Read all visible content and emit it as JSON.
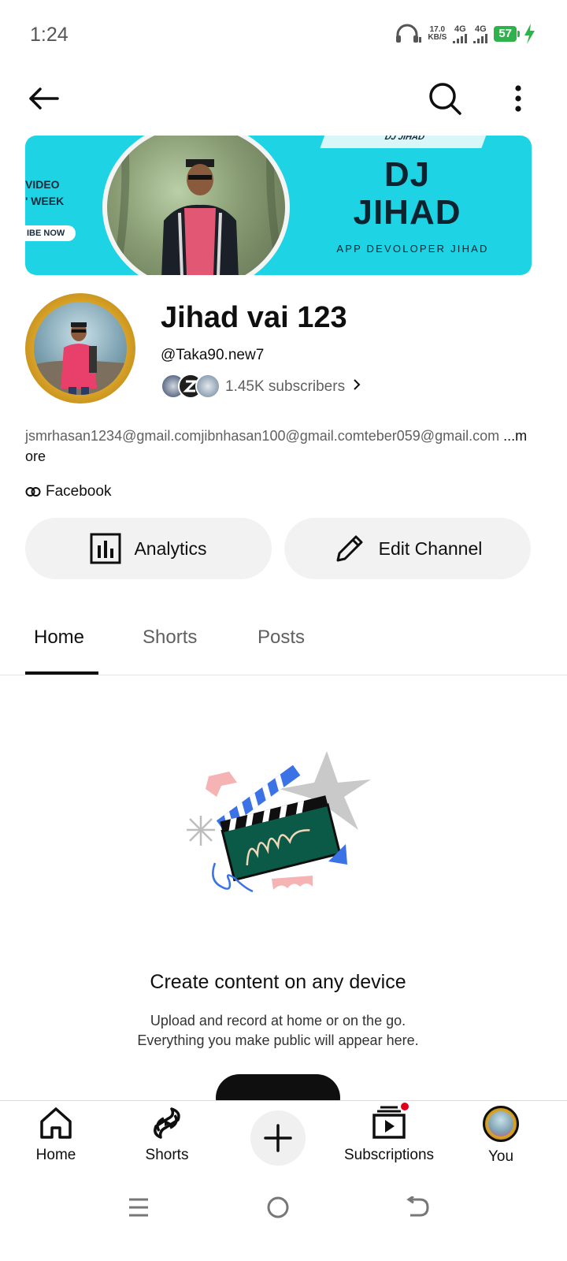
{
  "status_bar": {
    "time": "1:24",
    "net_speed_value": "17.0",
    "net_speed_unit": "KB/S",
    "signal1_label": "4G",
    "signal2_label": "4G",
    "battery": "57"
  },
  "top_bar": {
    "back_icon": "arrow-left-icon",
    "search_icon": "search-icon",
    "more_icon": "more-vert-icon"
  },
  "banner": {
    "top_tag": "DJ JIHAD",
    "left_line1": "VIDEO",
    "left_line2": "' WEEK",
    "left_pill": "IBE NOW",
    "title_line1": "DJ",
    "title_line2": "JIHAD",
    "tagline": "APP DEVOLOPER JIHAD"
  },
  "channel": {
    "name": "Jihad vai 123",
    "handle": "@Taka90.new7",
    "subscribers": "1.45K subscribers",
    "description": "jsmrhasan1234@gmail.comjibnhasan100@gmail.comteber059@gmail.com",
    "more_label": "...more",
    "link_label": "Facebook"
  },
  "actions": {
    "analytics_label": "Analytics",
    "edit_label": "Edit Channel"
  },
  "tabs": [
    {
      "label": "Home",
      "active": true
    },
    {
      "label": "Shorts",
      "active": false
    },
    {
      "label": "Posts",
      "active": false
    }
  ],
  "empty_state": {
    "title": "Create content on any device",
    "body_line1": "Upload and record at home or on the go.",
    "body_line2": "Everything you make public will appear here."
  },
  "bottom_nav": {
    "home": "Home",
    "shorts": "Shorts",
    "subscriptions": "Subscriptions",
    "you": "You"
  },
  "colors": {
    "banner_bg": "#1ed4e4",
    "battery": "#2fb24c",
    "notification_dot": "#e0001b",
    "illustration_green": "#0b5a48",
    "illustration_blue": "#3b73e6"
  }
}
